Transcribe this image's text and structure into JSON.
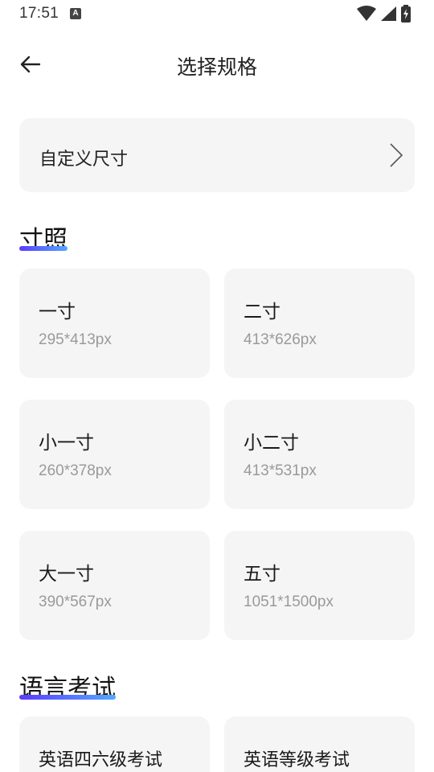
{
  "status": {
    "time": "17:51",
    "notif_icon_letter": "A"
  },
  "header": {
    "title": "选择规格"
  },
  "custom": {
    "label": "自定义尺寸"
  },
  "sections": [
    {
      "title": "寸照",
      "items": [
        {
          "name": "一寸",
          "size": "295*413px"
        },
        {
          "name": "二寸",
          "size": "413*626px"
        },
        {
          "name": "小一寸",
          "size": "260*378px"
        },
        {
          "name": "小二寸",
          "size": "413*531px"
        },
        {
          "name": "大一寸",
          "size": "390*567px"
        },
        {
          "name": "五寸",
          "size": "1051*1500px"
        }
      ]
    },
    {
      "title": "语言考试",
      "items": [
        {
          "name": "英语四六级考试",
          "size": ""
        },
        {
          "name": "英语等级考试",
          "size": ""
        }
      ]
    }
  ],
  "colors": {
    "accent_start": "#5b3cff",
    "accent_end": "#54a8ff",
    "card_bg": "#f5f5f5"
  }
}
